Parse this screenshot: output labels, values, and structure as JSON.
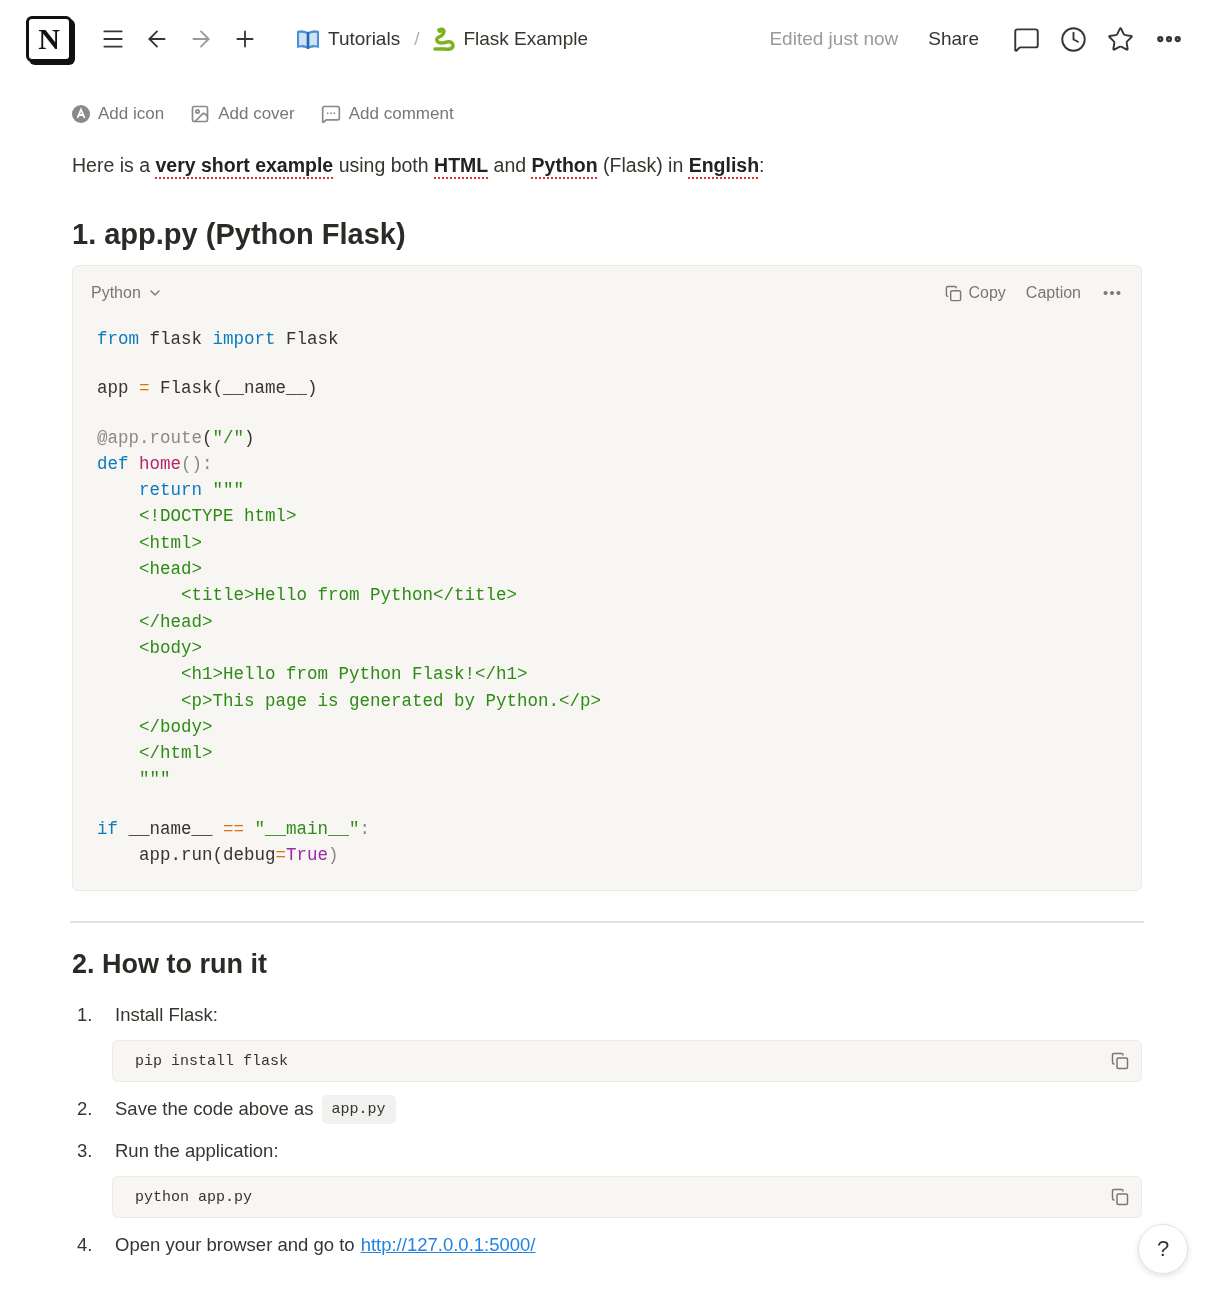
{
  "topbar": {
    "logo_letter": "N",
    "nav": [
      {
        "kind": "menu",
        "disabled": false
      },
      {
        "kind": "back",
        "disabled": false
      },
      {
        "kind": "forward",
        "disabled": true
      },
      {
        "kind": "add",
        "disabled": false
      }
    ],
    "breadcrumbs": [
      {
        "kind": "book",
        "label": "Tutorials"
      },
      {
        "kind": "snake",
        "label": "Flask Example"
      }
    ],
    "separator": "/",
    "edited": "Edited just now",
    "share": "Share",
    "actions": [
      {
        "kind": "comment"
      },
      {
        "kind": "history"
      },
      {
        "kind": "star"
      },
      {
        "kind": "more"
      }
    ]
  },
  "page_actions": [
    {
      "kind": "icon",
      "label": "Add icon"
    },
    {
      "kind": "cover",
      "label": "Add cover"
    },
    {
      "kind": "comment",
      "label": "Add comment"
    }
  ],
  "intro": [
    {
      "text": "Here is a ",
      "flagged": false
    },
    {
      "text": "very short example",
      "flagged": true
    },
    {
      "text": " using both ",
      "flagged": false
    },
    {
      "text": "HTML",
      "flagged": true
    },
    {
      "text": " and ",
      "flagged": false
    },
    {
      "text": "Python",
      "flagged": true
    },
    {
      "text": " (Flask) in ",
      "flagged": false
    },
    {
      "text": "English",
      "flagged": true
    },
    {
      "text": ":",
      "flagged": false
    }
  ],
  "heading_1": "1. app.py (Python Flask)",
  "code_block": {
    "language": "Python",
    "copy": "Copy",
    "caption": "Caption",
    "groups": [
      {
        "lines": [
          {
            "tokens": [
              {
                "kind": "keyword",
                "text": "from"
              },
              {
                "kind": "plain",
                "text": " flask "
              },
              {
                "kind": "keyword",
                "text": "import"
              },
              {
                "kind": "plain",
                "text": " Flask"
              }
            ]
          }
        ]
      },
      {
        "lines": [
          {
            "tokens": [
              {
                "kind": "plain",
                "text": "app "
              },
              {
                "kind": "operator",
                "text": "="
              },
              {
                "kind": "plain",
                "text": " Flask(__name__)"
              }
            ]
          }
        ]
      },
      {
        "lines": [
          {
            "tokens": [
              {
                "kind": "decorator",
                "text": "@app.route"
              },
              {
                "kind": "plain",
                "text": "("
              },
              {
                "kind": "string",
                "text": "\"/\""
              },
              {
                "kind": "plain",
                "text": ")"
              }
            ]
          },
          {
            "tokens": [
              {
                "kind": "keyword",
                "text": "def "
              },
              {
                "kind": "function",
                "text": "home"
              },
              {
                "kind": "punct",
                "text": "():"
              }
            ]
          },
          {
            "tokens": [
              {
                "kind": "keyword",
                "text": "    return "
              },
              {
                "kind": "string",
                "text": "\"\"\""
              }
            ]
          },
          {
            "tokens": [
              {
                "kind": "string",
                "text": "    <!DOCTYPE html>"
              }
            ]
          },
          {
            "tokens": [
              {
                "kind": "string",
                "text": "    <html>"
              }
            ]
          },
          {
            "tokens": [
              {
                "kind": "string",
                "text": "    <head>"
              }
            ]
          },
          {
            "tokens": [
              {
                "kind": "string",
                "text": "        <title>Hello from Python</title>"
              }
            ]
          },
          {
            "tokens": [
              {
                "kind": "string",
                "text": "    </head>"
              }
            ]
          },
          {
            "tokens": [
              {
                "kind": "string",
                "text": "    <body>"
              }
            ]
          },
          {
            "tokens": [
              {
                "kind": "string",
                "text": "        <h1>Hello from Python Flask!</h1>"
              }
            ]
          },
          {
            "tokens": [
              {
                "kind": "string",
                "text": "        <p>This page is generated by Python.</p>"
              }
            ]
          },
          {
            "tokens": [
              {
                "kind": "string",
                "text": "    </body>"
              }
            ]
          },
          {
            "tokens": [
              {
                "kind": "string",
                "text": "    </html>"
              }
            ]
          },
          {
            "tokens": [
              {
                "kind": "string",
                "text": "    \"\"\""
              }
            ]
          }
        ]
      },
      {
        "lines": [
          {
            "tokens": [
              {
                "kind": "keyword",
                "text": "if"
              },
              {
                "kind": "plain",
                "text": " __name__ "
              },
              {
                "kind": "operator",
                "text": "== "
              },
              {
                "kind": "string",
                "text": "\"__main__\""
              },
              {
                "kind": "punct",
                "text": ":"
              }
            ]
          },
          {
            "tokens": [
              {
                "kind": "plain",
                "text": "    app.run(debug"
              },
              {
                "kind": "operator",
                "text": "="
              },
              {
                "kind": "boolean",
                "text": "True"
              },
              {
                "kind": "punct",
                "text": ")"
              }
            ]
          }
        ]
      }
    ]
  },
  "heading_2": "2. How to run it",
  "steps": [
    {
      "number": "1.",
      "text": "Install Flask:",
      "code_block": "pip install flask"
    },
    {
      "number": "2.",
      "text": "Save the code above as",
      "inline_code": "app.py"
    },
    {
      "number": "3.",
      "text": "Run the application:",
      "code_block": "python app.py"
    },
    {
      "number": "4.",
      "text": "Open your browser and go to",
      "link": "http://127.0.0.1:5000/"
    }
  ],
  "help": "?"
}
